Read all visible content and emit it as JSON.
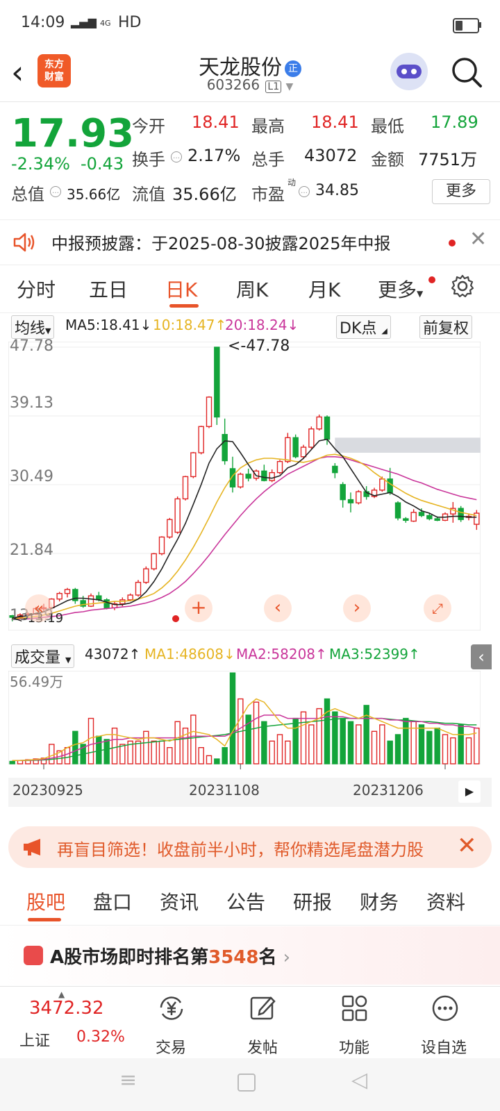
{
  "status_bar": {
    "time": "14:09",
    "signal": "4G",
    "network": "HD"
  },
  "header": {
    "logo_text_1": "东方",
    "logo_text_2": "财富",
    "stock_name": "天龙股份",
    "badge": "正",
    "stock_code": "603266",
    "level": "L1"
  },
  "quote": {
    "price": "17.93",
    "change_pct": "-2.34%",
    "change_abs": "-0.43",
    "open_label": "今开",
    "open": "18.41",
    "high_label": "最高",
    "high": "18.41",
    "low_label": "最低",
    "low": "17.89",
    "turnover_label": "换手",
    "turnover": "2.17%",
    "volume_label": "总手",
    "volume": "43072",
    "amount_label": "金额",
    "amount": "7751万",
    "mcap_label": "总值",
    "mcap": "35.66亿",
    "float_label": "流值",
    "float": "35.66亿",
    "pe_label": "市盈",
    "pe_sup": "动",
    "pe": "34.85",
    "more": "更多"
  },
  "notice": {
    "text": "中报预披露：于2025-08-30披露2025年中报"
  },
  "period_tabs": [
    "分时",
    "五日",
    "日K",
    "周K",
    "月K",
    "更多"
  ],
  "active_period": "日K",
  "ma_bar": {
    "selector": "均线",
    "ma5": "MA5:18.41↓",
    "ma10": "10:18.47↑",
    "ma20": "20:18.24↓",
    "dk": "DK点",
    "adjust": "前复权"
  },
  "price_axis": [
    "47.78",
    "39.13",
    "30.49",
    "21.84",
    "13.19"
  ],
  "max_marker": "<-47.78",
  "min_marker": "<-13.19",
  "volume_bar": {
    "selector": "成交量",
    "vol": "43072↑",
    "ma1": "MA1:48608↓",
    "ma2": "MA2:58208↑",
    "ma3": "MA3:52399↑"
  },
  "volume_axis_max": "56.49万",
  "dates": [
    "20230925",
    "20231108",
    "20231206"
  ],
  "ad": {
    "text": "再盲目筛选！收盘前半小时，帮你精选尾盘潜力股"
  },
  "bottom_tabs": [
    "股吧",
    "盘口",
    "资讯",
    "公告",
    "研报",
    "财务",
    "资料"
  ],
  "rank": {
    "prefix": "A股市场即时排名第",
    "number": "3548",
    "suffix": "名"
  },
  "index_widget": {
    "value": "3472.32",
    "name": "上证",
    "pct": "0.32%"
  },
  "nav": [
    "交易",
    "发帖",
    "功能",
    "设自选"
  ],
  "colors": {
    "up": "#e02424",
    "down": "#13a43a",
    "accent": "#e8542a"
  },
  "chart_data": {
    "type": "candlestick",
    "ylim": [
      13.19,
      47.78
    ],
    "candles": [
      [
        14.0,
        14.1,
        13.3,
        13.8
      ],
      [
        13.8,
        14.3,
        13.6,
        14.1
      ],
      [
        14.1,
        14.4,
        13.9,
        14.2
      ],
      [
        14.2,
        15.1,
        14.1,
        14.9
      ],
      [
        14.9,
        15.5,
        14.6,
        15.0
      ],
      [
        15.0,
        16.2,
        14.9,
        16.1
      ],
      [
        16.1,
        17.0,
        15.8,
        16.8
      ],
      [
        16.8,
        17.5,
        16.3,
        17.3
      ],
      [
        17.3,
        17.5,
        15.5,
        15.9
      ],
      [
        15.9,
        16.5,
        15.0,
        15.2
      ],
      [
        15.2,
        16.8,
        15.1,
        16.5
      ],
      [
        16.5,
        17.0,
        15.8,
        16.0
      ],
      [
        16.0,
        16.2,
        14.8,
        15.0
      ],
      [
        15.0,
        15.8,
        14.7,
        15.5
      ],
      [
        15.5,
        16.3,
        15.2,
        16.0
      ],
      [
        16.0,
        16.8,
        15.8,
        16.6
      ],
      [
        16.6,
        18.5,
        16.4,
        18.2
      ],
      [
        18.2,
        20.2,
        18.0,
        19.9
      ],
      [
        19.9,
        21.9,
        19.7,
        21.8
      ],
      [
        21.8,
        24.0,
        21.6,
        23.9
      ],
      [
        23.9,
        26.3,
        23.7,
        26.1
      ],
      [
        24.5,
        29.0,
        24.3,
        28.7
      ],
      [
        28.7,
        31.6,
        28.5,
        31.5
      ],
      [
        31.5,
        34.6,
        31.3,
        34.5
      ],
      [
        34.5,
        37.9,
        34.3,
        37.8
      ],
      [
        37.8,
        41.6,
        37.6,
        41.5
      ],
      [
        47.78,
        47.78,
        38.0,
        39.0
      ],
      [
        36.8,
        38.8,
        33.0,
        33.5
      ],
      [
        32.5,
        34.0,
        29.5,
        30.2
      ],
      [
        30.2,
        32.0,
        30.0,
        31.8
      ],
      [
        31.8,
        32.5,
        30.9,
        31.3
      ],
      [
        31.3,
        32.4,
        31.0,
        32.2
      ],
      [
        32.2,
        33.0,
        30.9,
        31.0
      ],
      [
        31.0,
        32.4,
        30.8,
        32.0
      ],
      [
        32.0,
        33.6,
        31.8,
        33.4
      ],
      [
        33.4,
        37.0,
        33.2,
        36.4
      ],
      [
        36.4,
        36.8,
        33.8,
        34.0
      ],
      [
        34.0,
        35.5,
        33.7,
        35.2
      ],
      [
        35.2,
        37.8,
        35.0,
        37.5
      ],
      [
        37.5,
        39.3,
        37.3,
        39.0
      ],
      [
        39.0,
        39.2,
        35.5,
        36.2
      ],
      [
        32.8,
        33.2,
        31.3,
        32.0
      ],
      [
        30.5,
        30.8,
        27.6,
        28.6
      ],
      [
        28.6,
        29.5,
        27.0,
        28.2
      ],
      [
        28.2,
        29.8,
        28.0,
        29.6
      ],
      [
        29.6,
        30.3,
        28.6,
        29.0
      ],
      [
        29.0,
        30.1,
        28.8,
        29.8
      ],
      [
        29.8,
        31.5,
        29.6,
        31.2
      ],
      [
        31.2,
        32.6,
        29.2,
        29.5
      ],
      [
        28.2,
        28.4,
        26.0,
        26.3
      ],
      [
        26.2,
        26.4,
        25.7,
        26.0
      ],
      [
        25.9,
        27.4,
        25.8,
        27.0
      ],
      [
        27.0,
        27.5,
        26.4,
        26.6
      ],
      [
        26.6,
        26.9,
        26.0,
        26.2
      ],
      [
        26.2,
        26.5,
        25.9,
        26.0
      ],
      [
        26.0,
        27.0,
        25.9,
        26.8
      ],
      [
        26.8,
        28.3,
        25.7,
        27.5
      ],
      [
        27.5,
        27.8,
        25.8,
        26.1
      ],
      [
        26.4,
        26.8,
        26.0,
        26.5
      ],
      [
        25.5,
        27.3,
        24.8,
        26.9
      ]
    ],
    "ma5": [
      13.7,
      13.9,
      14.0,
      14.3,
      14.5,
      14.9,
      15.4,
      15.9,
      16.2,
      16.2,
      16.1,
      16.0,
      15.7,
      15.4,
      15.4,
      15.6,
      16.1,
      17.0,
      18.3,
      19.9,
      21.8,
      23.6,
      25.6,
      28.0,
      30.5,
      33.2,
      35.0,
      36.0,
      35.9,
      34.5,
      33.0,
      31.6,
      31.4,
      31.3,
      31.6,
      32.6,
      33.0,
      33.8,
      34.9,
      36.0,
      36.2,
      35.0,
      34.0,
      32.5,
      31.0,
      29.5,
      29.1,
      29.3,
      29.5,
      29.0,
      28.3,
      27.8,
      27.2,
      26.9,
      26.4,
      26.4,
      26.5,
      26.5,
      26.4,
      26.4
    ],
    "ma10": [
      13.6,
      13.7,
      13.8,
      13.9,
      14.1,
      14.3,
      14.6,
      14.9,
      15.2,
      15.4,
      15.5,
      15.6,
      15.7,
      15.8,
      15.8,
      15.9,
      16.1,
      16.4,
      16.8,
      17.5,
      18.4,
      19.6,
      21.0,
      22.6,
      24.4,
      26.3,
      28.3,
      30.1,
      31.6,
      32.6,
      33.2,
      33.6,
      33.8,
      33.8,
      33.7,
      33.6,
      33.4,
      33.3,
      33.5,
      33.8,
      34.2,
      34.3,
      34.1,
      33.8,
      33.4,
      32.8,
      32.0,
      31.3,
      30.6,
      30.0,
      29.4,
      28.9,
      28.5,
      28.2,
      27.9,
      27.6,
      27.3,
      27.0,
      26.8,
      26.6
    ],
    "ma20": [
      13.5,
      13.6,
      13.6,
      13.7,
      13.8,
      13.9,
      14.0,
      14.2,
      14.4,
      14.5,
      14.7,
      14.8,
      14.9,
      15.0,
      15.1,
      15.2,
      15.4,
      15.6,
      15.9,
      16.3,
      16.8,
      17.5,
      18.3,
      19.3,
      20.4,
      21.6,
      22.9,
      24.2,
      25.4,
      26.6,
      27.7,
      28.7,
      29.6,
      30.4,
      31.1,
      31.8,
      32.3,
      32.8,
      33.3,
      33.8,
      34.0,
      34.0,
      33.9,
      33.6,
      33.3,
      33.0,
      32.7,
      32.4,
      32.1,
      31.8,
      31.4,
      31.0,
      30.7,
      30.3,
      29.9,
      29.6,
      29.3,
      29.0,
      28.8,
      28.6
    ],
    "volume_ylim": [
      0,
      56.49
    ],
    "volume": [
      1.5,
      2.0,
      2.5,
      3.0,
      3.5,
      12,
      8,
      10,
      20,
      12,
      28,
      17,
      15,
      22,
      12,
      14,
      14,
      20,
      14,
      14,
      10,
      26,
      22,
      30,
      10,
      5,
      3,
      10,
      56,
      40,
      30,
      38,
      26,
      14,
      18,
      14,
      28,
      32,
      24,
      34,
      40,
      32,
      28,
      26,
      24,
      36,
      20,
      24,
      14,
      18,
      28,
      26,
      24,
      20,
      22,
      18,
      16,
      24,
      16,
      22
    ],
    "vol_ma1": [
      2,
      2.1,
      2.3,
      2.7,
      3.2,
      5,
      7,
      10,
      12,
      13,
      16,
      17,
      18,
      18,
      17,
      16,
      15,
      16,
      16,
      15,
      14,
      16,
      18,
      20,
      19,
      18,
      15,
      11,
      20,
      28,
      36,
      40,
      38,
      32,
      26,
      22,
      22,
      24,
      26,
      28,
      32,
      34,
      32,
      30,
      28,
      30,
      28,
      26,
      24,
      22,
      22,
      22,
      22,
      22,
      22,
      20,
      18,
      18,
      18,
      19
    ],
    "vol_ma2": [
      2,
      2.1,
      2.2,
      2.4,
      2.7,
      3.5,
      4.5,
      6,
      8,
      10,
      12,
      13,
      14,
      15,
      15,
      16,
      16,
      16,
      16,
      16,
      16,
      16,
      16,
      17,
      17,
      17,
      17,
      17,
      19,
      22,
      25,
      28,
      30,
      30,
      30,
      28,
      28,
      28,
      28,
      28,
      29,
      29,
      29,
      28,
      28,
      28,
      28,
      28,
      27,
      27,
      26,
      26,
      26,
      25,
      25,
      24,
      24,
      23,
      23,
      22
    ],
    "vol_ma3": [
      2,
      2,
      2.1,
      2.2,
      2.4,
      2.8,
      3.3,
      4,
      5,
      6,
      7,
      8,
      9,
      10,
      11,
      12,
      12.5,
      13,
      13.5,
      14,
      14.5,
      15,
      15.5,
      16,
      16.5,
      17,
      17.5,
      18,
      19,
      20,
      21,
      22,
      23,
      23.5,
      24,
      24.5,
      25,
      25.5,
      26,
      26.5,
      27,
      27.5,
      28,
      28,
      28,
      28,
      28,
      28,
      27.5,
      27,
      27,
      26.5,
      26,
      26,
      25.5,
      25,
      25,
      24.5,
      24,
      24
    ]
  }
}
